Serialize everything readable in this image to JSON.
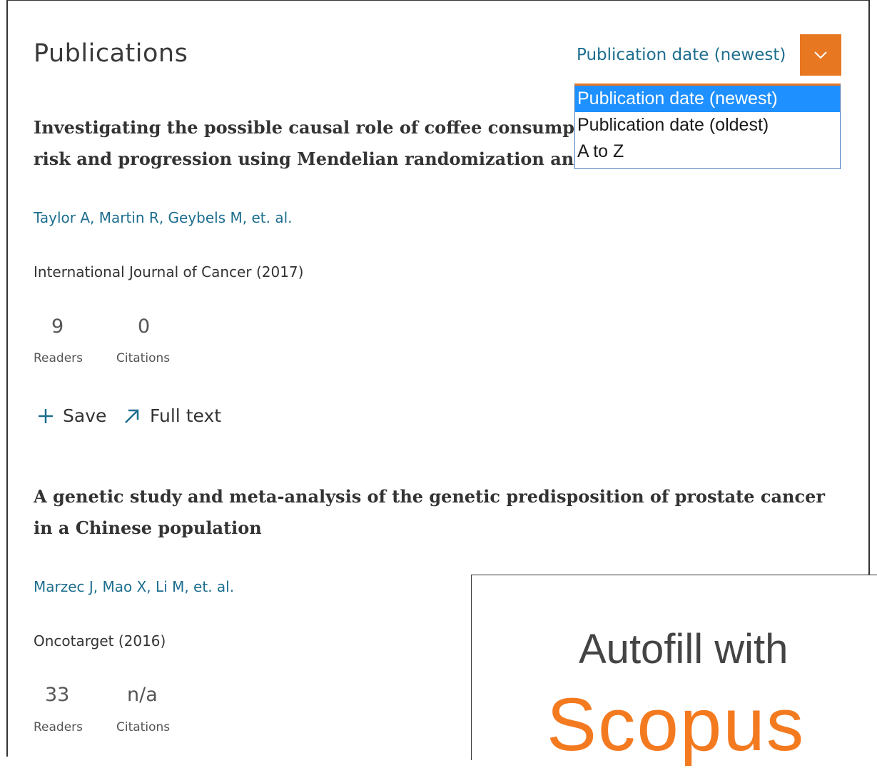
{
  "header": {
    "title": "Publications",
    "sort_selected": "Publication date (newest)"
  },
  "sort_options": [
    {
      "label": "Publication date (newest)",
      "selected": true
    },
    {
      "label": "Publication date (oldest)",
      "selected": false
    },
    {
      "label": "A to Z",
      "selected": false
    }
  ],
  "articles": [
    {
      "title_line1": "Investigating the possible causal role of coffee consumption v",
      "title_line2": "risk and progression using Mendelian randomization analysis",
      "authors": "Taylor A, Martin R, Geybels M, et. al.",
      "journal": "International Journal of Cancer (2017)",
      "readers": "9",
      "readers_label": "Readers",
      "citations": "0",
      "citations_label": "Citations",
      "save_label": "Save",
      "fulltext_label": "Full text"
    },
    {
      "title_line1": "A genetic study and meta-analysis of the genetic predisposition of prostate cancer",
      "title_line2": "in a Chinese population",
      "authors": "Marzec J, Mao X, Li M, et. al.",
      "journal": "Oncotarget (2016)",
      "readers": "33",
      "readers_label": "Readers",
      "citations": "n/a",
      "citations_label": "Citations"
    }
  ],
  "overlay": {
    "line1": "Autofill with",
    "line2": "Scopus"
  },
  "colors": {
    "accent": "#e87722",
    "link": "#1d6e8e",
    "selected_option": "#1e90ff",
    "scopus": "#f47a20"
  }
}
